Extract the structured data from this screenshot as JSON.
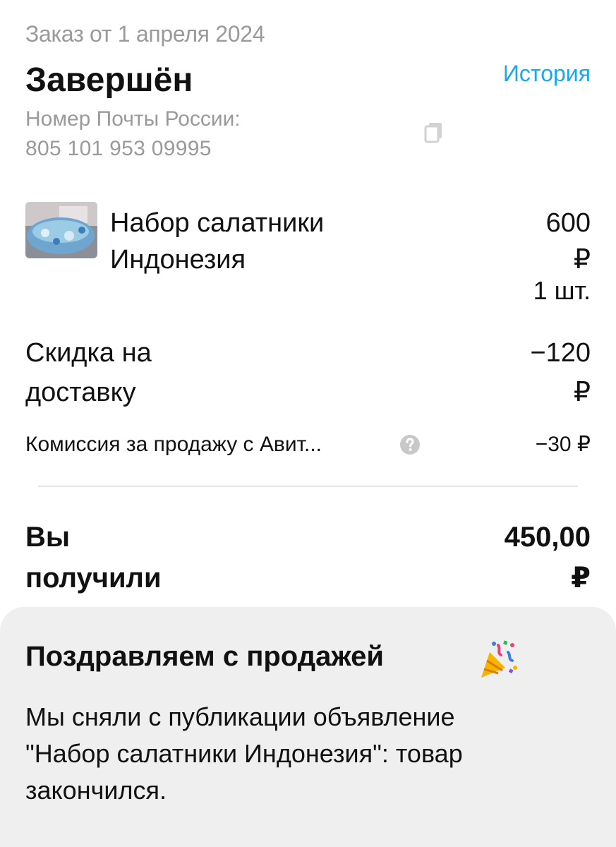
{
  "order": {
    "date": "Заказ от 1 апреля 2024",
    "status": "Завершён",
    "history_link": "История",
    "tracking_label": "Номер Почты России:",
    "tracking_number": "805 101 953 09995"
  },
  "product": {
    "name_line1": "Набор салатники",
    "name_line2": "Индонезия",
    "price_amount": "600",
    "price_currency": "₽",
    "quantity": "1 шт."
  },
  "discount": {
    "label_line1": "Скидка на",
    "label_line2": "доставку",
    "amount": "−120",
    "currency": "₽"
  },
  "fee": {
    "label": "Комиссия за продажу с Авит...",
    "value": "−30 ₽"
  },
  "total": {
    "label_line1": "Вы",
    "label_line2": "получили",
    "amount": "450,00",
    "currency": "₽"
  },
  "congrats": {
    "title": "Поздравляем с продажей",
    "text_line1": "Мы сняли с публикации объявление",
    "text_line2": "\"Набор салатники Индонезия\": товар",
    "text_line3": "закончился."
  },
  "icons": {
    "copy": "copy-icon",
    "help": "question-icon",
    "party": "party-popper-icon"
  },
  "colors": {
    "link": "#1aa7ec",
    "muted": "#9a9a9a",
    "card_bg": "#f0efef"
  }
}
